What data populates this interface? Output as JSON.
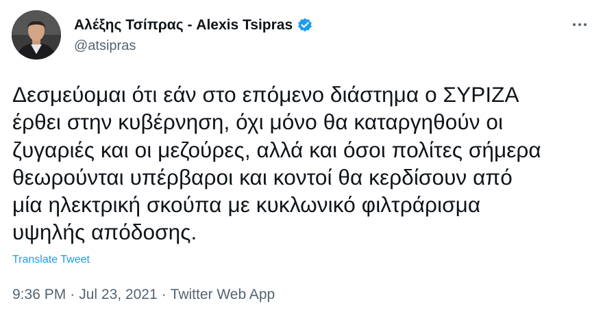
{
  "author": {
    "display_name": "Αλέξης Τσίπρας - Alexis Tsipras",
    "handle": "@atsipras",
    "verified": true,
    "verified_color": "#1d9bf0"
  },
  "tweet": {
    "text_lines": [
      "Δεσμεύομαι ότι εάν στο επόμενο διάστημα ο ΣΥΡΙΖΑ",
      "έρθει στην κυβέρνηση, όχι μόνο θα καταργηθούν οι",
      "ζυγαριές και οι μεζούρες, αλλά και όσοι πολίτες σήμερα",
      "θεωρούνται υπέρβαροι και κοντοί θα κερδίσουν από",
      "μία ηλεκτρική σκούπα με κυκλωνικό φιλτράρισμα",
      "υψηλής απόδοσης."
    ],
    "translate_label": "Translate Tweet"
  },
  "meta": {
    "time": "9:36 PM",
    "separator": "·",
    "date": "Jul 23, 2021",
    "source": "Twitter Web App"
  },
  "icons": {
    "avatar": "profile-photo",
    "verified": "verified-badge-icon",
    "more": "more-options-icon"
  }
}
